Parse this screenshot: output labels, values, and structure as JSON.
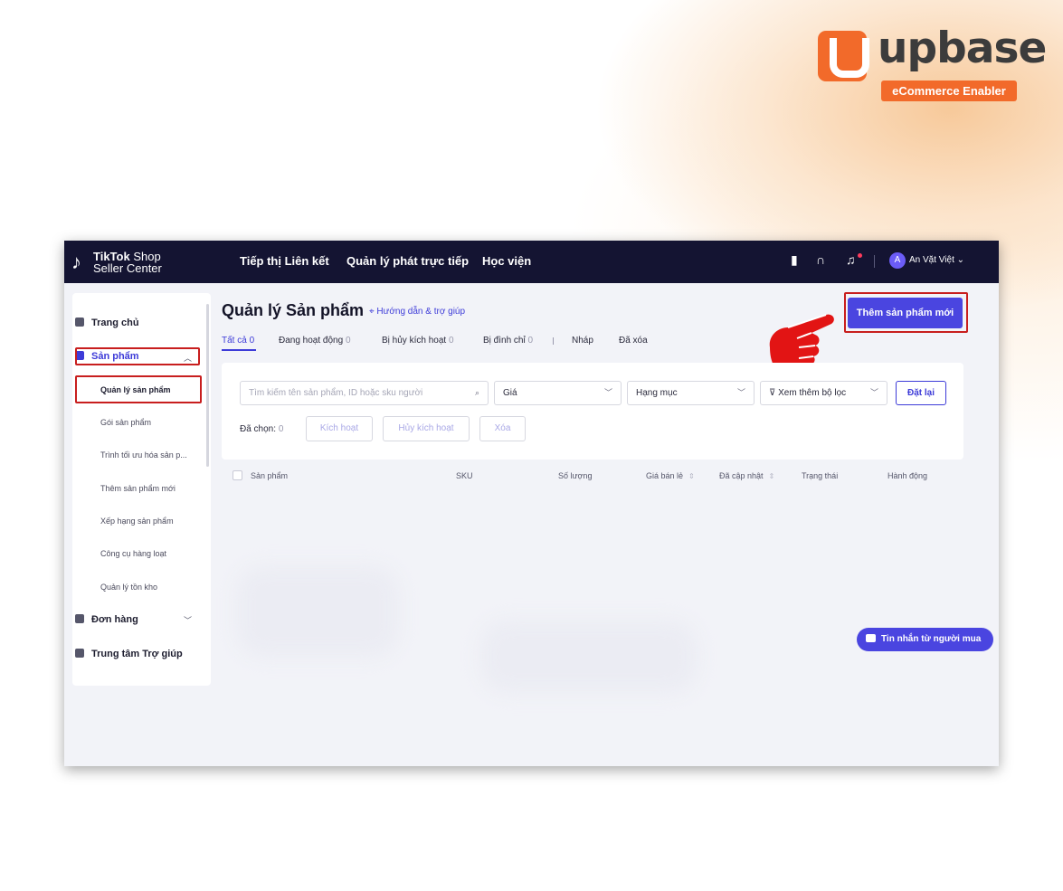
{
  "brand": {
    "logo_word": "upbase",
    "logo_tagline": "eCommerce Enabler",
    "accent": "#f26a2a"
  },
  "topbar": {
    "logo_line1_bold": "TikTok",
    "logo_line1_rest": " Shop",
    "logo_line2": "Seller Center",
    "nav": [
      "Tiếp thị Liên kết",
      "Quản lý phát trực tiếp",
      "Học viện"
    ],
    "user_name": "An Vặt Việt",
    "icons": [
      "phone-icon",
      "headset-icon",
      "bell-icon"
    ]
  },
  "sidebar": {
    "home": "Trang chủ",
    "products": "Sản phẩm",
    "sub_items": [
      "Quản lý sản phẩm",
      "Gói sản phẩm",
      "Trình tối ưu hóa sản p...",
      "Thêm sản phẩm mới",
      "Xếp hạng sản phẩm",
      "Công cụ hàng loạt",
      "Quản lý tồn kho"
    ],
    "orders": "Đơn hàng",
    "help_center": "Trung tâm Trợ giúp"
  },
  "main": {
    "title": "Quản lý Sản phẩm",
    "help_link": "Hướng dẫn & trợ giúp",
    "add_button": "Thêm sản phẩm mới",
    "tabs": [
      {
        "label": "Tất cả",
        "count": "0"
      },
      {
        "label": "Đang hoạt động",
        "count": "0"
      },
      {
        "label": "Bị hủy kích hoạt",
        "count": "0"
      },
      {
        "label": "Bị đình chỉ",
        "count": "0"
      },
      {
        "label": "Nháp",
        "count": ""
      },
      {
        "label": "Đã xóa",
        "count": ""
      }
    ],
    "filters": {
      "search_placeholder": "Tìm kiếm tên sản phẩm, ID hoặc sku người",
      "price": "Giá",
      "category": "Hạng mục",
      "more_filters": "Xem thêm bộ lọc",
      "reset": "Đặt lại",
      "selected_label": "Đã chọn:",
      "selected_count": "0",
      "activate": "Kích hoạt",
      "deactivate": "Hủy kích hoạt",
      "delete": "Xóa"
    },
    "table_headers": [
      "Sản phẩm",
      "SKU",
      "Số lượng",
      "Giá bán lẻ",
      "Đã cập nhật",
      "Trạng thái",
      "Hành động"
    ],
    "chat_button": "Tin nhắn từ người mua"
  }
}
